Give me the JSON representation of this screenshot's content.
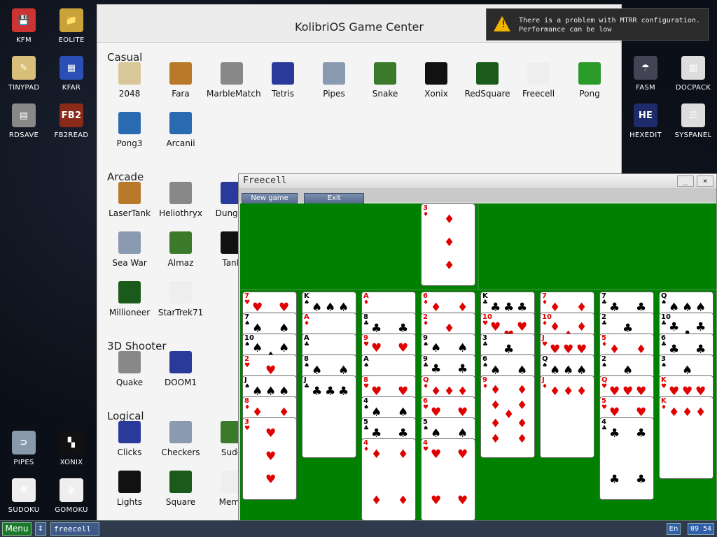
{
  "desktop_icons": [
    {
      "id": "kfm",
      "label": "KFM",
      "color": "#c33",
      "glyph": "💾"
    },
    {
      "id": "eolite",
      "label": "EOLITE",
      "color": "#c9a23a",
      "glyph": "📁"
    },
    {
      "id": "tinypad",
      "label": "TINYPAD",
      "color": "#d9c07a",
      "glyph": "✎"
    },
    {
      "id": "kfar",
      "label": "KFAR",
      "color": "#2a4fb5",
      "glyph": "▦"
    },
    {
      "id": "rdsave",
      "label": "RDSAVE",
      "color": "#888",
      "glyph": "▤"
    },
    {
      "id": "fb2read",
      "label": "FB2READ",
      "color": "#8a2a1a",
      "glyph": "FB2"
    },
    {
      "id": "fasm",
      "label": "FASM",
      "color": "#445",
      "glyph": "☂"
    },
    {
      "id": "docpack",
      "label": "DOCPACK",
      "color": "#ddd",
      "glyph": "▥"
    },
    {
      "id": "hexedit",
      "label": "HEXEDIT",
      "color": "#1d2b6a",
      "glyph": "HE"
    },
    {
      "id": "syspanel",
      "label": "SYSPANEL",
      "color": "#ddd",
      "glyph": "☰"
    },
    {
      "id": "pipes",
      "label": "PIPES",
      "color": "#89a",
      "glyph": "⊃"
    },
    {
      "id": "xonix",
      "label": "XONIX",
      "color": "#111",
      "glyph": "▚"
    },
    {
      "id": "sudoku",
      "label": "SUDOKU",
      "color": "#eee",
      "glyph": "#"
    },
    {
      "id": "gomoku",
      "label": "GOMOKU",
      "color": "#eee",
      "glyph": "⊗"
    }
  ],
  "game_center": {
    "title": "KolibriOS Game Center",
    "sections": [
      {
        "name": "Casual",
        "games": [
          "2048",
          "Fara",
          "MarbleMatch",
          "Tetris",
          "Pipes",
          "Snake",
          "Xonix",
          "RedSquare",
          "Freecell",
          "Pong",
          "Pong3",
          "Arcanii"
        ]
      },
      {
        "name": "Arcade",
        "games": [
          "LaserTank",
          "Heliothryx",
          "Dungeons",
          "Sea War",
          "Almaz",
          "Tanks",
          "Millioneer",
          "StarTrek71"
        ]
      },
      {
        "name": "3D Shooter",
        "games": [
          "Quake",
          "DOOM1"
        ]
      },
      {
        "name": "Logical",
        "games": [
          "Clicks",
          "Checkers",
          "Sudoku",
          "Lights",
          "Square",
          "Memory"
        ]
      }
    ],
    "visible_labels": {
      "Dungeons": "Dungeo",
      "Tanks": "Tank",
      "Sudoku": "Sudo",
      "Memory": "Memo"
    }
  },
  "notification": {
    "line1": "There is a problem with MTRR configuration.",
    "line2": "Performance can be low"
  },
  "freecell": {
    "title": "Freecell",
    "buttons": {
      "new_game": "New game",
      "exit": "Exit"
    },
    "min_label": "_",
    "close_label": "×",
    "colors": {
      "felt": "#008000",
      "red": "#e00000",
      "black": "#000000"
    },
    "foundation_card": {
      "rank": "3",
      "suit": "♦"
    },
    "columns": [
      [
        [
          "7",
          "♥"
        ],
        [
          "7",
          "♠"
        ],
        [
          "10",
          "♠"
        ],
        [
          "2",
          "♥"
        ],
        [
          "J",
          "♠"
        ],
        [
          "8",
          "♦"
        ],
        [
          "3",
          "♥"
        ]
      ],
      [
        [
          "K",
          "♠"
        ],
        [
          "A",
          "♦"
        ],
        [
          "A",
          "♣"
        ],
        [
          "8",
          "♠"
        ],
        [
          "J",
          "♣"
        ]
      ],
      [
        [
          "A",
          "♦"
        ],
        [
          "8",
          "♣"
        ],
        [
          "9",
          "♥"
        ],
        [
          "A",
          "♠"
        ],
        [
          "8",
          "♥"
        ],
        [
          "4",
          "♠"
        ],
        [
          "5",
          "♣"
        ],
        [
          "4",
          "♦"
        ]
      ],
      [
        [
          "6",
          "♦"
        ],
        [
          "2",
          "♦"
        ],
        [
          "9",
          "♠"
        ],
        [
          "9",
          "♣"
        ],
        [
          "Q",
          "♦"
        ],
        [
          "6",
          "♥"
        ],
        [
          "5",
          "♠"
        ],
        [
          "4",
          "♥"
        ]
      ],
      [
        [
          "K",
          "♣"
        ],
        [
          "10",
          "♥"
        ],
        [
          "3",
          "♣"
        ],
        [
          "6",
          "♠"
        ],
        [
          "9",
          "♦"
        ]
      ],
      [
        [
          "7",
          "♦"
        ],
        [
          "10",
          "♦"
        ],
        [
          "J",
          "♥"
        ],
        [
          "Q",
          "♠"
        ],
        [
          "J",
          "♦"
        ]
      ],
      [
        [
          "7",
          "♣"
        ],
        [
          "2",
          "♣"
        ],
        [
          "5",
          "♦"
        ],
        [
          "2",
          "♠"
        ],
        [
          "Q",
          "♥"
        ],
        [
          "5",
          "♥"
        ],
        [
          "4",
          "♣"
        ]
      ],
      [
        [
          "Q",
          "♠"
        ],
        [
          "10",
          "♣"
        ],
        [
          "6",
          "♣"
        ],
        [
          "3",
          "♠"
        ],
        [
          "K",
          "♥"
        ],
        [
          "K",
          "♦"
        ]
      ]
    ]
  },
  "taskbar": {
    "menu_label": "Menu",
    "arrow_label": "↕",
    "task_label": "freecell",
    "lang": "En",
    "clock": "09 54"
  }
}
